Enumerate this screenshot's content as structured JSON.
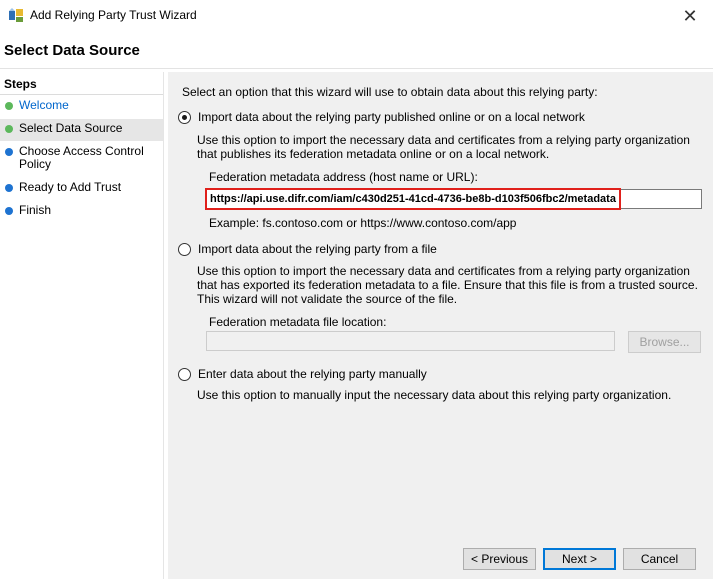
{
  "window": {
    "title": "Add Relying Party Trust Wizard",
    "close_glyph": "✕"
  },
  "page_title": "Select Data Source",
  "steps": {
    "heading": "Steps",
    "items": [
      {
        "label": "Welcome",
        "color": "#0066cc",
        "dot": "#5cb85c"
      },
      {
        "label": "Select Data Source",
        "color": "#000000",
        "dot": "#5cb85c"
      },
      {
        "label": "Choose Access Control Policy",
        "color": "#000000",
        "dot": "#1e73d1"
      },
      {
        "label": "Ready to Add Trust",
        "color": "#000000",
        "dot": "#1e73d1"
      },
      {
        "label": "Finish",
        "color": "#000000",
        "dot": "#1e73d1"
      }
    ]
  },
  "main": {
    "intro": "Select an option that this wizard will use to obtain data about this relying party:",
    "option_online": {
      "label": "Import data about the relying party published online or on a local network",
      "selected": true,
      "description": "Use this option to import the necessary data and certificates from a relying party organization that publishes its federation metadata online or on a local network.",
      "field_label": "Federation metadata address (host name or URL):",
      "field_value": "https://api.use.difr.com/iam/c430d251-41cd-4736-be8b-d103f506fbc2/metadata",
      "example": "Example: fs.contoso.com or https://www.contoso.com/app"
    },
    "option_file": {
      "label": "Import data about the relying party from a file",
      "selected": false,
      "description": "Use this option to import the necessary data and certificates from a relying party organization that has exported its federation metadata to a file. Ensure that this file is from a trusted source.  This wizard will not validate the source of the file.",
      "field_label": "Federation metadata file location:",
      "field_value": "",
      "browse_label": "Browse..."
    },
    "option_manual": {
      "label": "Enter data about the relying party manually",
      "selected": false,
      "description": "Use this option to manually input the necessary data about this relying party organization."
    }
  },
  "footer": {
    "previous_label": "< Previous",
    "next_label": "Next >",
    "cancel_label": "Cancel"
  },
  "colors": {
    "highlight": "#e0201b",
    "accent": "#0078d7"
  }
}
